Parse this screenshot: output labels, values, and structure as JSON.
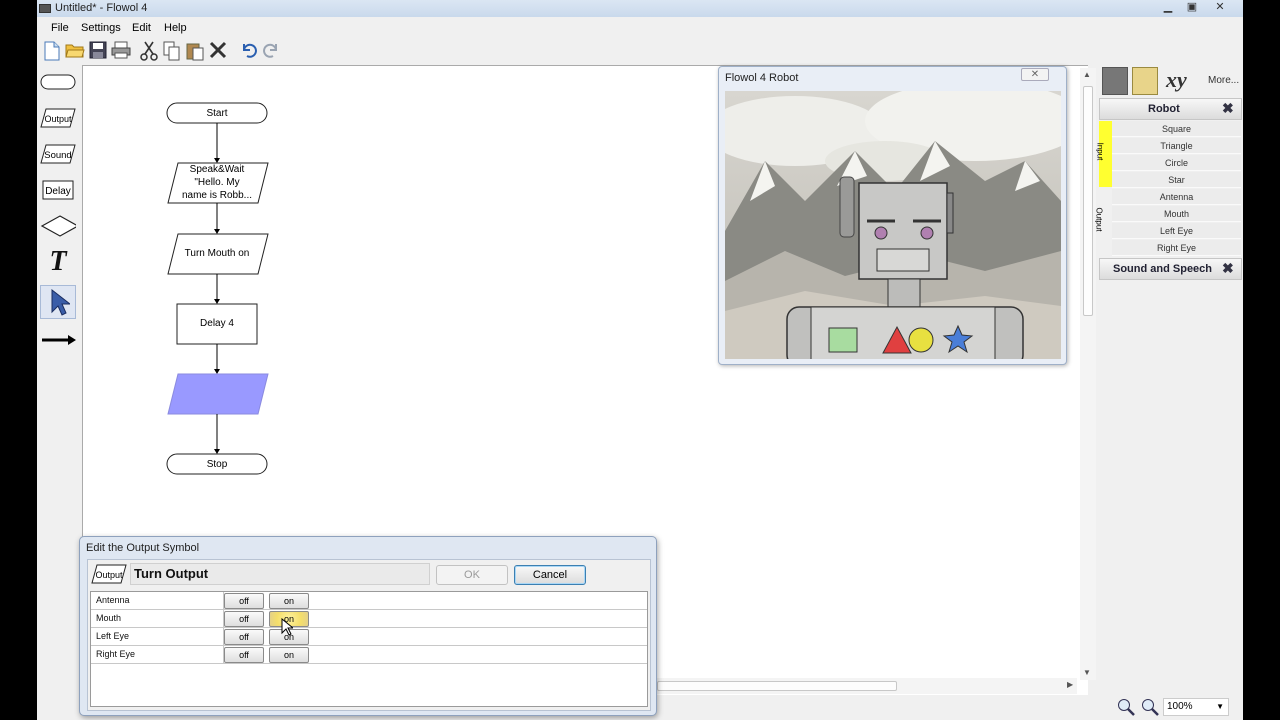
{
  "window": {
    "title": "Untitled* - Flowol 4"
  },
  "menu": [
    "File",
    "Settings",
    "Edit",
    "Help"
  ],
  "toolbar": [
    "new-file-icon",
    "open-folder-icon",
    "save-icon",
    "print-icon",
    "cut-icon",
    "copy-icon",
    "paste-icon",
    "delete-icon",
    "undo-icon",
    "redo-icon"
  ],
  "palette": {
    "output": "Output",
    "sound": "Sound",
    "delay": "Delay",
    "text": "T"
  },
  "flowchart": {
    "start": "Start",
    "speak_line1": "Speak&Wait",
    "speak_line2": "\"Hello. My",
    "speak_line3": "name is Robb...",
    "turn_mouth": "Turn Mouth on",
    "delay": "Delay 4",
    "stop": "Stop",
    "highlight_color": "#9999ff"
  },
  "robot_window": {
    "title": "Flowol 4 Robot"
  },
  "right_panel": {
    "more": "More...",
    "robot_header": "Robot",
    "input_tab": "Input",
    "output_tab": "Output",
    "inputs": [
      "Square",
      "Triangle",
      "Circle",
      "Star"
    ],
    "outputs": [
      "Antenna",
      "Mouth",
      "Left Eye",
      "Right Eye"
    ],
    "sound_header": "Sound and Speech"
  },
  "status": {
    "zoom": "100%"
  },
  "dialog": {
    "title": "Edit the Output Symbol",
    "badge": "Output",
    "name": "Turn Output",
    "ok": "OK",
    "cancel": "Cancel",
    "rows": [
      {
        "label": "Antenna",
        "off": "off",
        "on": "on"
      },
      {
        "label": "Mouth",
        "off": "off",
        "on": "on"
      },
      {
        "label": "Left Eye",
        "off": "off",
        "on": "on"
      },
      {
        "label": "Right Eye",
        "off": "off",
        "on": "on"
      }
    ]
  }
}
